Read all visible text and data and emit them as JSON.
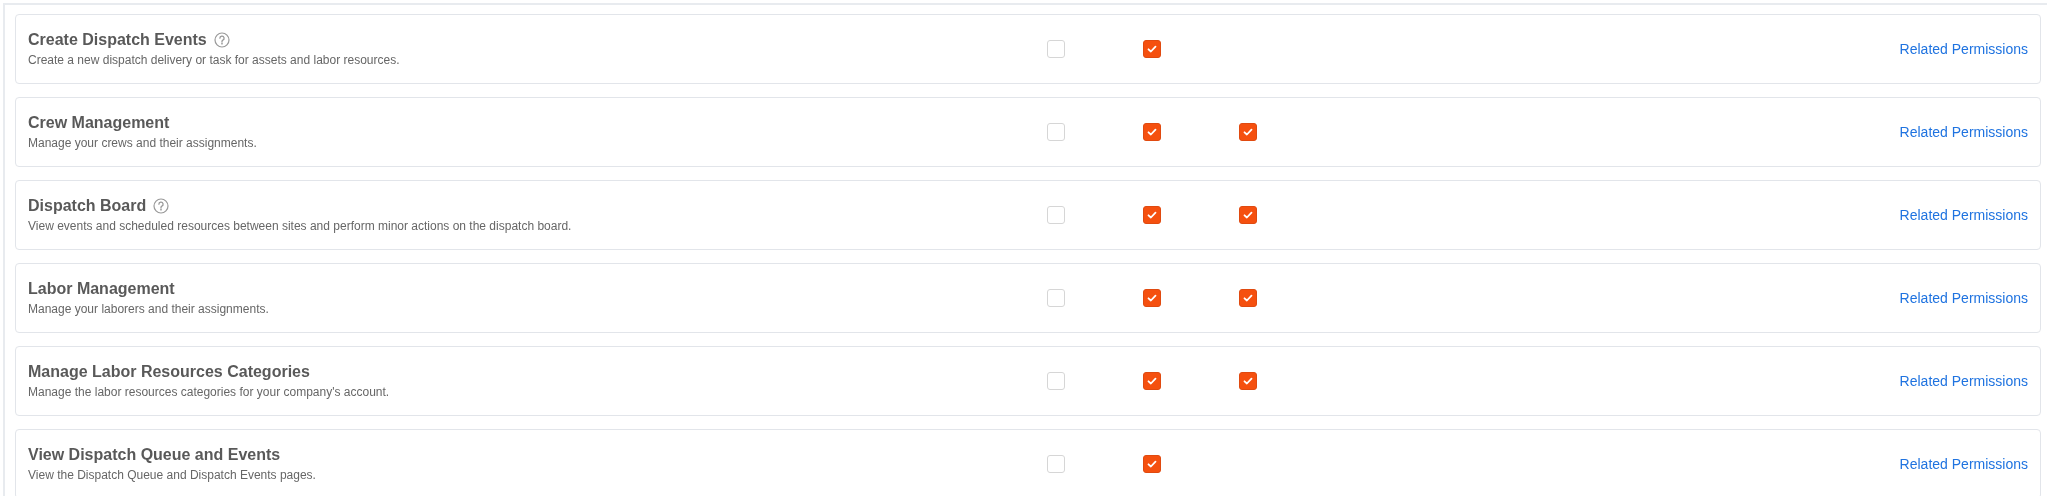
{
  "permissions": [
    {
      "title": "Create Dispatch Events",
      "help": true,
      "description": "Create a new dispatch delivery or task for assets and labor resources.",
      "checkboxes": [
        {
          "checked": false
        },
        {
          "checked": true
        }
      ],
      "link": "Related Permissions"
    },
    {
      "title": "Crew Management",
      "help": false,
      "description": "Manage your crews and their assignments.",
      "checkboxes": [
        {
          "checked": false
        },
        {
          "checked": true
        },
        {
          "checked": true
        }
      ],
      "link": "Related Permissions"
    },
    {
      "title": "Dispatch Board",
      "help": true,
      "description": "View events and scheduled resources between sites and perform minor actions on the dispatch board.",
      "checkboxes": [
        {
          "checked": false
        },
        {
          "checked": true
        },
        {
          "checked": true
        }
      ],
      "link": "Related Permissions"
    },
    {
      "title": "Labor Management",
      "help": false,
      "description": "Manage your laborers and their assignments.",
      "checkboxes": [
        {
          "checked": false
        },
        {
          "checked": true
        },
        {
          "checked": true
        }
      ],
      "link": "Related Permissions"
    },
    {
      "title": "Manage Labor Resources Categories",
      "help": false,
      "description": "Manage the labor resources categories for your company's account.",
      "checkboxes": [
        {
          "checked": false
        },
        {
          "checked": true
        },
        {
          "checked": true
        }
      ],
      "link": "Related Permissions"
    },
    {
      "title": "View Dispatch Queue and Events",
      "help": false,
      "description": "View the Dispatch Queue and Dispatch Events pages.",
      "checkboxes": [
        {
          "checked": false
        },
        {
          "checked": true
        }
      ],
      "link": "Related Permissions"
    }
  ]
}
